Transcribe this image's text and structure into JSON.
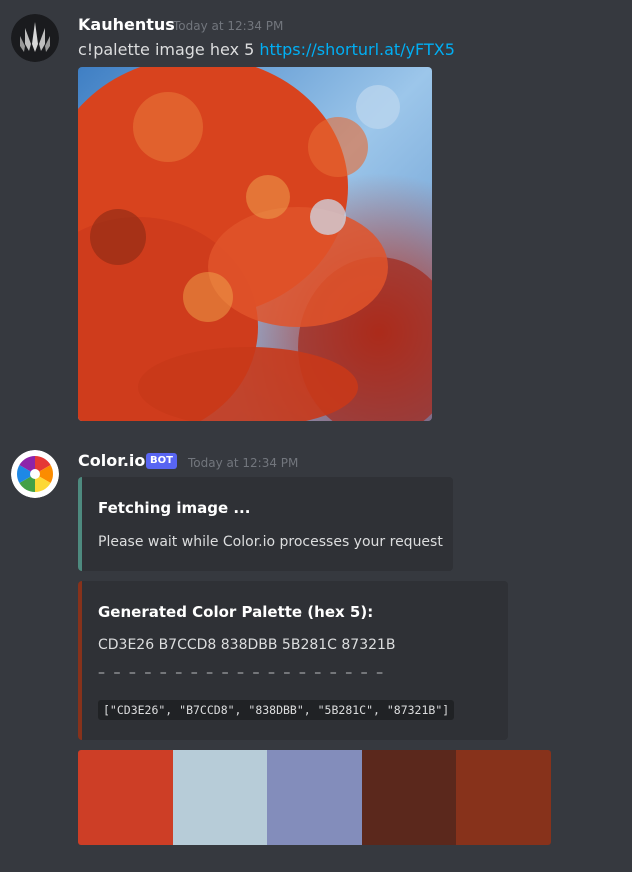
{
  "message1": {
    "username": "Kauhentus",
    "timestamp": "Today at 12:34 PM",
    "text": "c!palette image hex 5",
    "link": "https://shorturl.at/yFTX5"
  },
  "message2": {
    "username": "Color.io",
    "bot_tag": "BOT",
    "timestamp": "Today at 12:34 PM"
  },
  "embed1": {
    "title": "Fetching image ...",
    "description": "Please wait while Color.io processes your request",
    "accent": "#4e8a7f"
  },
  "embed2": {
    "title": "Generated Color Palette (hex 5):",
    "description": "CD3E26 B7CCD8 838DBB 5B281C 87321B",
    "dashes": "– – – – – – – – – – – – – – – – – – –",
    "code": "[\"CD3E26\", \"B7CCD8\", \"838DBB\", \"5B281C\", \"87321B\"]",
    "accent": "#87321b"
  },
  "palette": [
    "#CD3E26",
    "#B7CCD8",
    "#838DBB",
    "#5B281C",
    "#87321B"
  ]
}
